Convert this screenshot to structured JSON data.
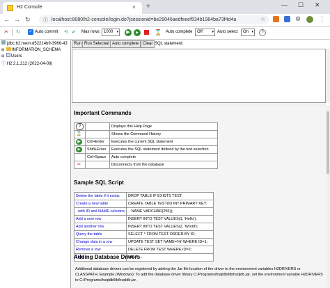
{
  "browser": {
    "tab_title": "H2 Console",
    "url": "localhost:8080/h2-console/login.do?jsessionid=be29046aedfeeef534b1984ba73f4d4a",
    "new_tab": "+",
    "close": "×"
  },
  "toolbar": {
    "auto_commit_label": "Auto commit",
    "max_rows_label": "Max rows:",
    "max_rows_value": "1000",
    "auto_complete_label": "Auto complete",
    "auto_complete_value": "Off",
    "auto_select_label": "Auto select",
    "auto_select_value": "On"
  },
  "tree": {
    "db_url": "jdbc:h2:mem:d52214b9-3966-43",
    "items": [
      "INFORMATION_SCHEMA",
      "Users"
    ],
    "version": "H2 2.1.212 (2022-04-09)"
  },
  "query": {
    "run": "Run",
    "run_selected": "Run Selected",
    "auto_complete": "Auto complete",
    "clear": "Clear",
    "sql_label": "SQL statement:"
  },
  "important": {
    "heading": "Important Commands",
    "rows": [
      {
        "icon": "help-icon",
        "key": "",
        "desc": "Displays this Help Page"
      },
      {
        "icon": "history-icon",
        "key": "",
        "desc": "Shows the Command History"
      },
      {
        "icon": "run-icon",
        "key": "Ctrl+Enter",
        "desc": "Executes the current SQL statement"
      },
      {
        "icon": "run-selected-icon",
        "key": "Shift+Enter",
        "desc": "Executes the SQL statement defined by the text selection"
      },
      {
        "icon": "",
        "key": "Ctrl+Space",
        "desc": "Auto complete"
      },
      {
        "icon": "disconnect-icon",
        "key": "",
        "desc": "Disconnects from the database"
      }
    ]
  },
  "sample": {
    "heading": "Sample SQL Script",
    "rows": [
      {
        "link": "Delete the table if it exists",
        "sql": "DROP TABLE IF EXISTS TEST;"
      },
      {
        "link": "Create a new table",
        "sql": "CREATE TABLE TEST(ID INT PRIMARY KEY,"
      },
      {
        "link": "  with ID and NAME columns",
        "sql": "   NAME VARCHAR(255));"
      },
      {
        "link": "Add a new row",
        "sql": "INSERT INTO TEST VALUES(1, 'Hello');"
      },
      {
        "link": "Add another row",
        "sql": "INSERT INTO TEST VALUES(2, 'World');"
      },
      {
        "link": "Query the table",
        "sql": "SELECT * FROM TEST ORDER BY ID;"
      },
      {
        "link": "Change data in a row",
        "sql": "UPDATE TEST SET NAME='Hi' WHERE ID=1;"
      },
      {
        "link": "Remove a row",
        "sql": "DELETE FROM TEST WHERE ID=2;"
      },
      {
        "link": "Help",
        "sql": "HELP ..."
      }
    ]
  },
  "drivers": {
    "heading": "Adding Database Drivers",
    "text": "Additional database drivers can be registered by adding the Jar file location of the driver to the environment variables H2DRIVERS or CLASSPATH. Example (Windows): To add the database driver library C:/Programs/hsqldb/lib/hsqldb.jar, set the environment variable H2DRIVERS to C:/Programs/hsqldb/lib/hsqldb.jar."
  }
}
